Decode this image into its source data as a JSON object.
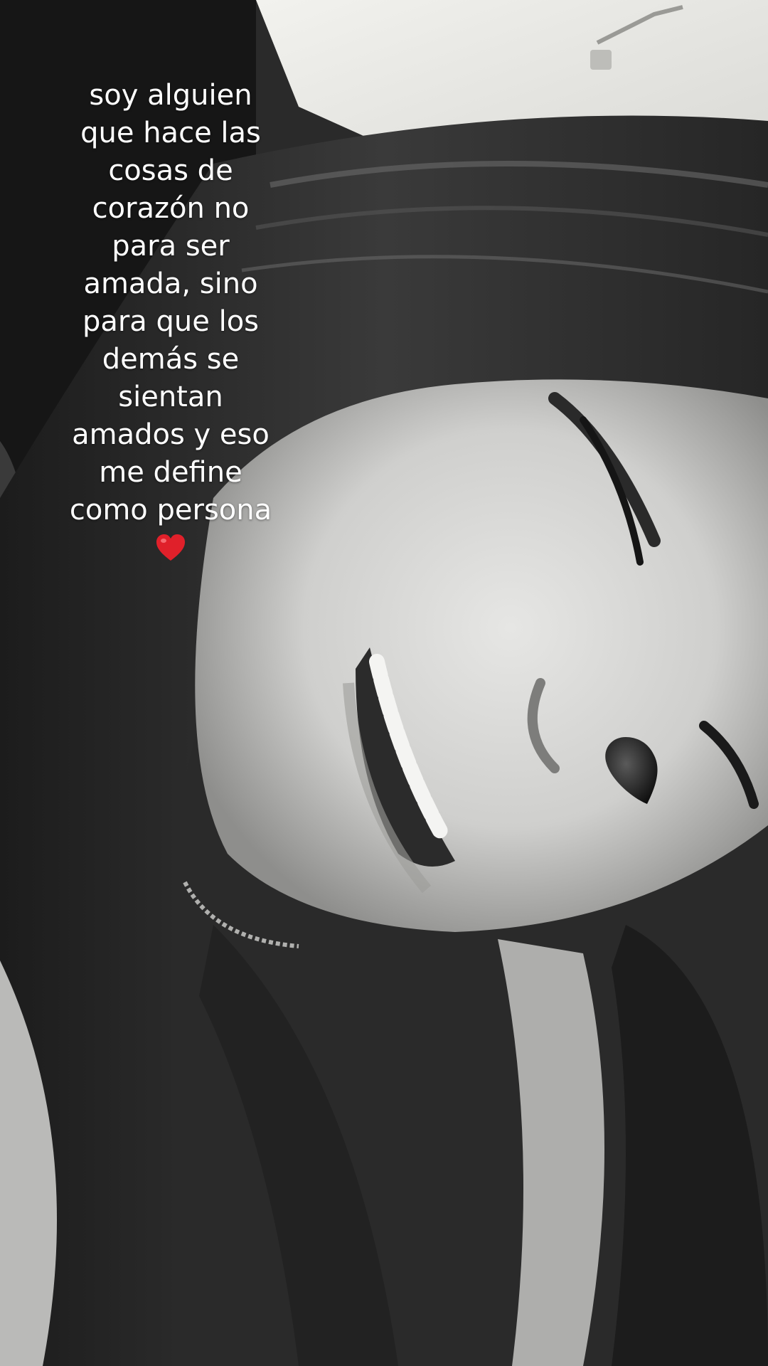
{
  "caption": {
    "lines": [
      "soy alguien",
      "que hace las",
      "cosas de",
      "corazón no",
      "para ser",
      "amada, sino",
      "para que los",
      "demás se",
      "sientan",
      "amados y eso",
      "me define",
      "como persona"
    ],
    "emoji": "heart-icon",
    "emoji_color": "#e0202a"
  },
  "photo": {
    "style": "black-and-white",
    "nose_sticker": "heart-sticker-icon"
  }
}
